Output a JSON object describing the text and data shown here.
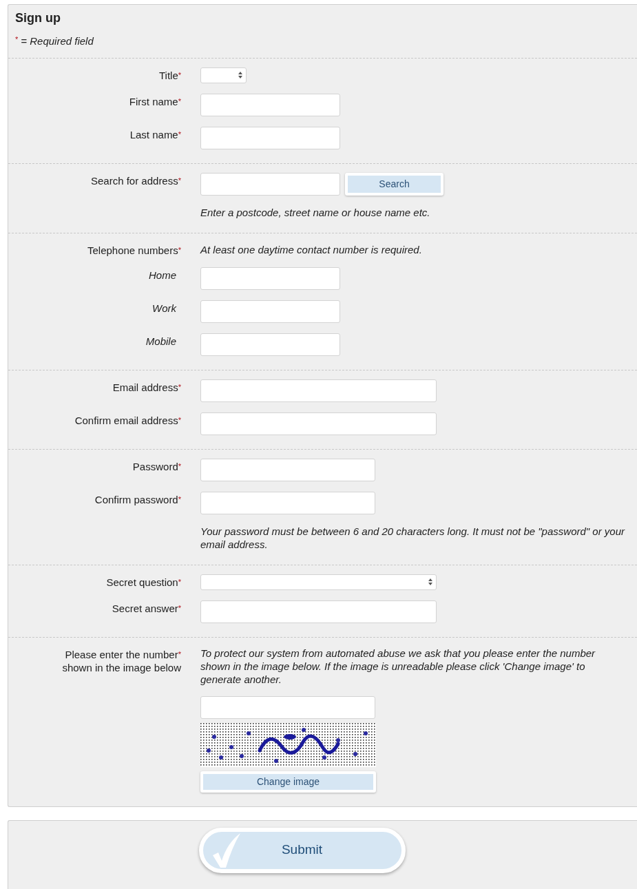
{
  "form": {
    "title": "Sign up",
    "required_mark": "*",
    "required_note": "= Required field"
  },
  "sections": [
    {
      "rows": [
        {
          "label": "Title",
          "required": true,
          "controls": [
            {
              "kind": "select"
            }
          ]
        },
        {
          "label": "First name",
          "required": true,
          "controls": [
            {
              "kind": "input"
            }
          ]
        },
        {
          "label": "Last name",
          "required": true,
          "controls": [
            {
              "kind": "input"
            }
          ]
        }
      ]
    },
    {
      "rows": [
        {
          "label": "Search for address",
          "required": true,
          "controls": [
            {
              "kind": "input"
            },
            {
              "kind": "button",
              "text": "Search"
            }
          ]
        },
        {
          "controls": [
            {
              "kind": "note",
              "text": "Enter a postcode, street name or house name etc."
            }
          ]
        }
      ]
    },
    {
      "rows": [
        {
          "label": "Telephone numbers",
          "required": true,
          "controls": [
            {
              "kind": "note",
              "text": "At least one daytime contact number is required."
            }
          ]
        },
        {
          "label": "Home",
          "required": false,
          "label_italic": true,
          "controls": [
            {
              "kind": "input"
            }
          ]
        },
        {
          "label": "Work",
          "required": false,
          "label_italic": true,
          "controls": [
            {
              "kind": "input"
            }
          ]
        },
        {
          "label": "Mobile",
          "required": false,
          "label_italic": true,
          "controls": [
            {
              "kind": "input"
            }
          ]
        }
      ]
    },
    {
      "rows": [
        {
          "label": "Email address",
          "required": true,
          "controls": [
            {
              "kind": "wideinput"
            }
          ]
        },
        {
          "label": "Confirm email address",
          "required": true,
          "controls": [
            {
              "kind": "wideinput"
            }
          ]
        }
      ]
    },
    {
      "rows": [
        {
          "label": "Password",
          "required": true,
          "controls": [
            {
              "kind": "midinput"
            }
          ]
        },
        {
          "label": "Confirm password",
          "required": true,
          "controls": [
            {
              "kind": "midinput"
            }
          ]
        },
        {
          "controls": [
            {
              "kind": "note",
              "text": "Your password must be between 6 and 20 characters long. It must not be \"password\" or your email address."
            }
          ]
        }
      ]
    },
    {
      "rows": [
        {
          "label": "Secret question",
          "required": true,
          "controls": [
            {
              "kind": "wideselect"
            }
          ]
        },
        {
          "label": "Secret answer",
          "required": true,
          "controls": [
            {
              "kind": "wideinput"
            }
          ]
        }
      ]
    },
    {
      "rows": [
        {
          "label": "Please enter the number",
          "label_continued": "shown in the image below",
          "required": true,
          "controls": [
            {
              "kind": "note",
              "text": "To protect our system from automated abuse we ask that you please enter the number shown in the image below. If the image is unreadable please click 'Change image' to generate another."
            }
          ]
        },
        {
          "controls": [
            {
              "kind": "midinput"
            }
          ]
        },
        {
          "controls": [
            {
              "kind": "captcha"
            }
          ]
        },
        {
          "controls": [
            {
              "kind": "widebutton",
              "text": "Change image"
            }
          ]
        }
      ]
    }
  ],
  "submit": {
    "text": "Submit"
  }
}
